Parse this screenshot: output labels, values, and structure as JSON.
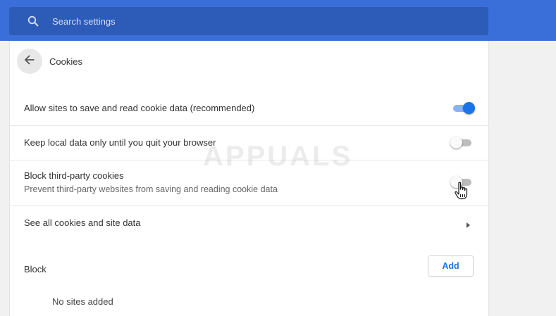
{
  "search": {
    "placeholder": "Search settings",
    "icon": "search-icon"
  },
  "header": {
    "title": "Cookies",
    "back_icon": "arrow-left-icon"
  },
  "settings": [
    {
      "label": "Allow sites to save and read cookie data (recommended)",
      "sublabel": "",
      "control": "toggle",
      "checked": true
    },
    {
      "label": "Keep local data only until you quit your browser",
      "sublabel": "",
      "control": "toggle",
      "checked": false
    },
    {
      "label": "Block third-party cookies",
      "sublabel": "Prevent third-party websites from saving and reading cookie data",
      "control": "toggle",
      "checked": false
    },
    {
      "label": "See all cookies and site data",
      "sublabel": "",
      "control": "chevron",
      "icon": "chevron-right-icon"
    }
  ],
  "block_section": {
    "label": "Block",
    "add_label": "Add",
    "empty_text": "No sites added"
  },
  "watermark": "APPUALS",
  "colors": {
    "topbar": "#3a6ed8",
    "search_bg": "#2d5bb8",
    "accent": "#1a73e8",
    "toggle_off": "#bdbdbd"
  }
}
